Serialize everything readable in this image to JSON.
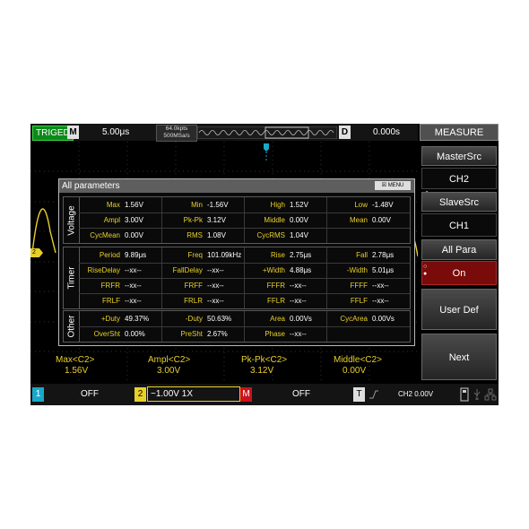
{
  "topbar": {
    "trig_status": "TRIGED",
    "m_label": "M",
    "timebase": "5.00μs",
    "memory_depth": "64.0kpts",
    "sample_rate": "500MSa/s",
    "d_label": "D",
    "delay": "0.000s"
  },
  "menu": {
    "title": "MEASURE",
    "items": [
      {
        "label": "MasterSrc"
      },
      {
        "label": "CH2"
      },
      {
        "label": "SlaveSrc"
      },
      {
        "label": "CH1"
      },
      {
        "label": "All Para"
      },
      {
        "label": "On"
      },
      {
        "label": "User Def"
      },
      {
        "label": "Next"
      }
    ]
  },
  "dialog": {
    "title": "All parameters",
    "menu_chip": "MENU",
    "groups": [
      {
        "label": "Voltage",
        "rows": [
          [
            {
              "n": "Max",
              "v": "1.56V"
            },
            {
              "n": "Min",
              "v": "-1.56V"
            },
            {
              "n": "High",
              "v": "1.52V"
            },
            {
              "n": "Low",
              "v": "-1.48V"
            }
          ],
          [
            {
              "n": "Ampl",
              "v": "3.00V"
            },
            {
              "n": "Pk-Pk",
              "v": "3.12V"
            },
            {
              "n": "Middle",
              "v": "0.00V"
            },
            {
              "n": "Mean",
              "v": "0.00V"
            }
          ],
          [
            {
              "n": "CycMean",
              "v": "0.00V"
            },
            {
              "n": "RMS",
              "v": "1.08V"
            },
            {
              "n": "CycRMS",
              "v": "1.04V"
            },
            {
              "n": "",
              "v": ""
            }
          ]
        ]
      },
      {
        "label": "Timer",
        "rows": [
          [
            {
              "n": "Period",
              "v": "9.89μs"
            },
            {
              "n": "Freq",
              "v": "101.09kHz"
            },
            {
              "n": "Rise",
              "v": "2.75μs"
            },
            {
              "n": "Fall",
              "v": "2.78μs"
            }
          ],
          [
            {
              "n": "RiseDelay",
              "v": "--xx--"
            },
            {
              "n": "FallDelay",
              "v": "--xx--"
            },
            {
              "n": "+Width",
              "v": "4.88μs"
            },
            {
              "n": "-Width",
              "v": "5.01μs"
            }
          ],
          [
            {
              "n": "FRFR",
              "v": "--xx--"
            },
            {
              "n": "FRFF",
              "v": "--xx--"
            },
            {
              "n": "FFFR",
              "v": "--xx--"
            },
            {
              "n": "FFFF",
              "v": "--xx--"
            }
          ],
          [
            {
              "n": "FRLF",
              "v": "--xx--"
            },
            {
              "n": "FRLR",
              "v": "--xx--"
            },
            {
              "n": "FFLR",
              "v": "--xx--"
            },
            {
              "n": "FFLF",
              "v": "--xx--"
            }
          ]
        ]
      },
      {
        "label": "Other",
        "rows": [
          [
            {
              "n": "+Duty",
              "v": "49.37%"
            },
            {
              "n": "-Duty",
              "v": "50.63%"
            },
            {
              "n": "Area",
              "v": "0.00Vs"
            },
            {
              "n": "CycArea",
              "v": "0.00Vs"
            }
          ],
          [
            {
              "n": "OverSht",
              "v": "0.00%"
            },
            {
              "n": "PreSht",
              "v": "2.67%"
            },
            {
              "n": "Phase",
              "v": "--xx--"
            },
            {
              "n": "",
              "v": ""
            }
          ]
        ]
      }
    ]
  },
  "summary": [
    {
      "name": "Max<C2>",
      "value": "1.56V"
    },
    {
      "name": "Ampl<C2>",
      "value": "3.00V"
    },
    {
      "name": "Pk-Pk<C2>",
      "value": "3.12V"
    },
    {
      "name": "Middle<C2>",
      "value": "0.00V"
    }
  ],
  "bottom": {
    "ch1_num": "1",
    "ch1_state": "OFF",
    "ch2_num": "2",
    "ch2_state": "~1.00V 1X",
    "m_label": "M",
    "m_state": "OFF",
    "t_label": "T",
    "trig_info": "CH2 0.00V"
  },
  "markers": {
    "ch2_marker": "2",
    "trig_marker": "T"
  },
  "colors": {
    "ch1": "#1aa8c8",
    "ch2": "#e8d02a",
    "trig_ok": "#0b8a1a",
    "menu_active": "#7a0b0b"
  }
}
